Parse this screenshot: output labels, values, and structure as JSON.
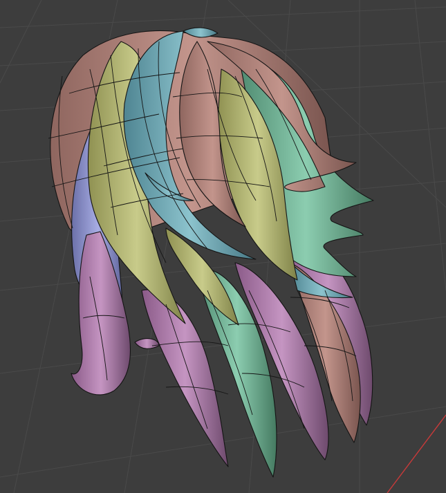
{
  "viewport": {
    "kind": "3d-viewport",
    "object": "hair-mesh",
    "background_color": "#3d3d3d",
    "grid_line_color": "#4a4a4a",
    "x_axis_color": "#c93a3a",
    "wireframe_color": "#141414"
  },
  "mesh": {
    "strand_colors": {
      "salmon": "#bf8e86",
      "yellow_green": "#bcc07f",
      "teal": "#7fb4be",
      "green": "#7fbea0",
      "pink": "#b888b6",
      "periwinkle": "#9da2db"
    }
  }
}
